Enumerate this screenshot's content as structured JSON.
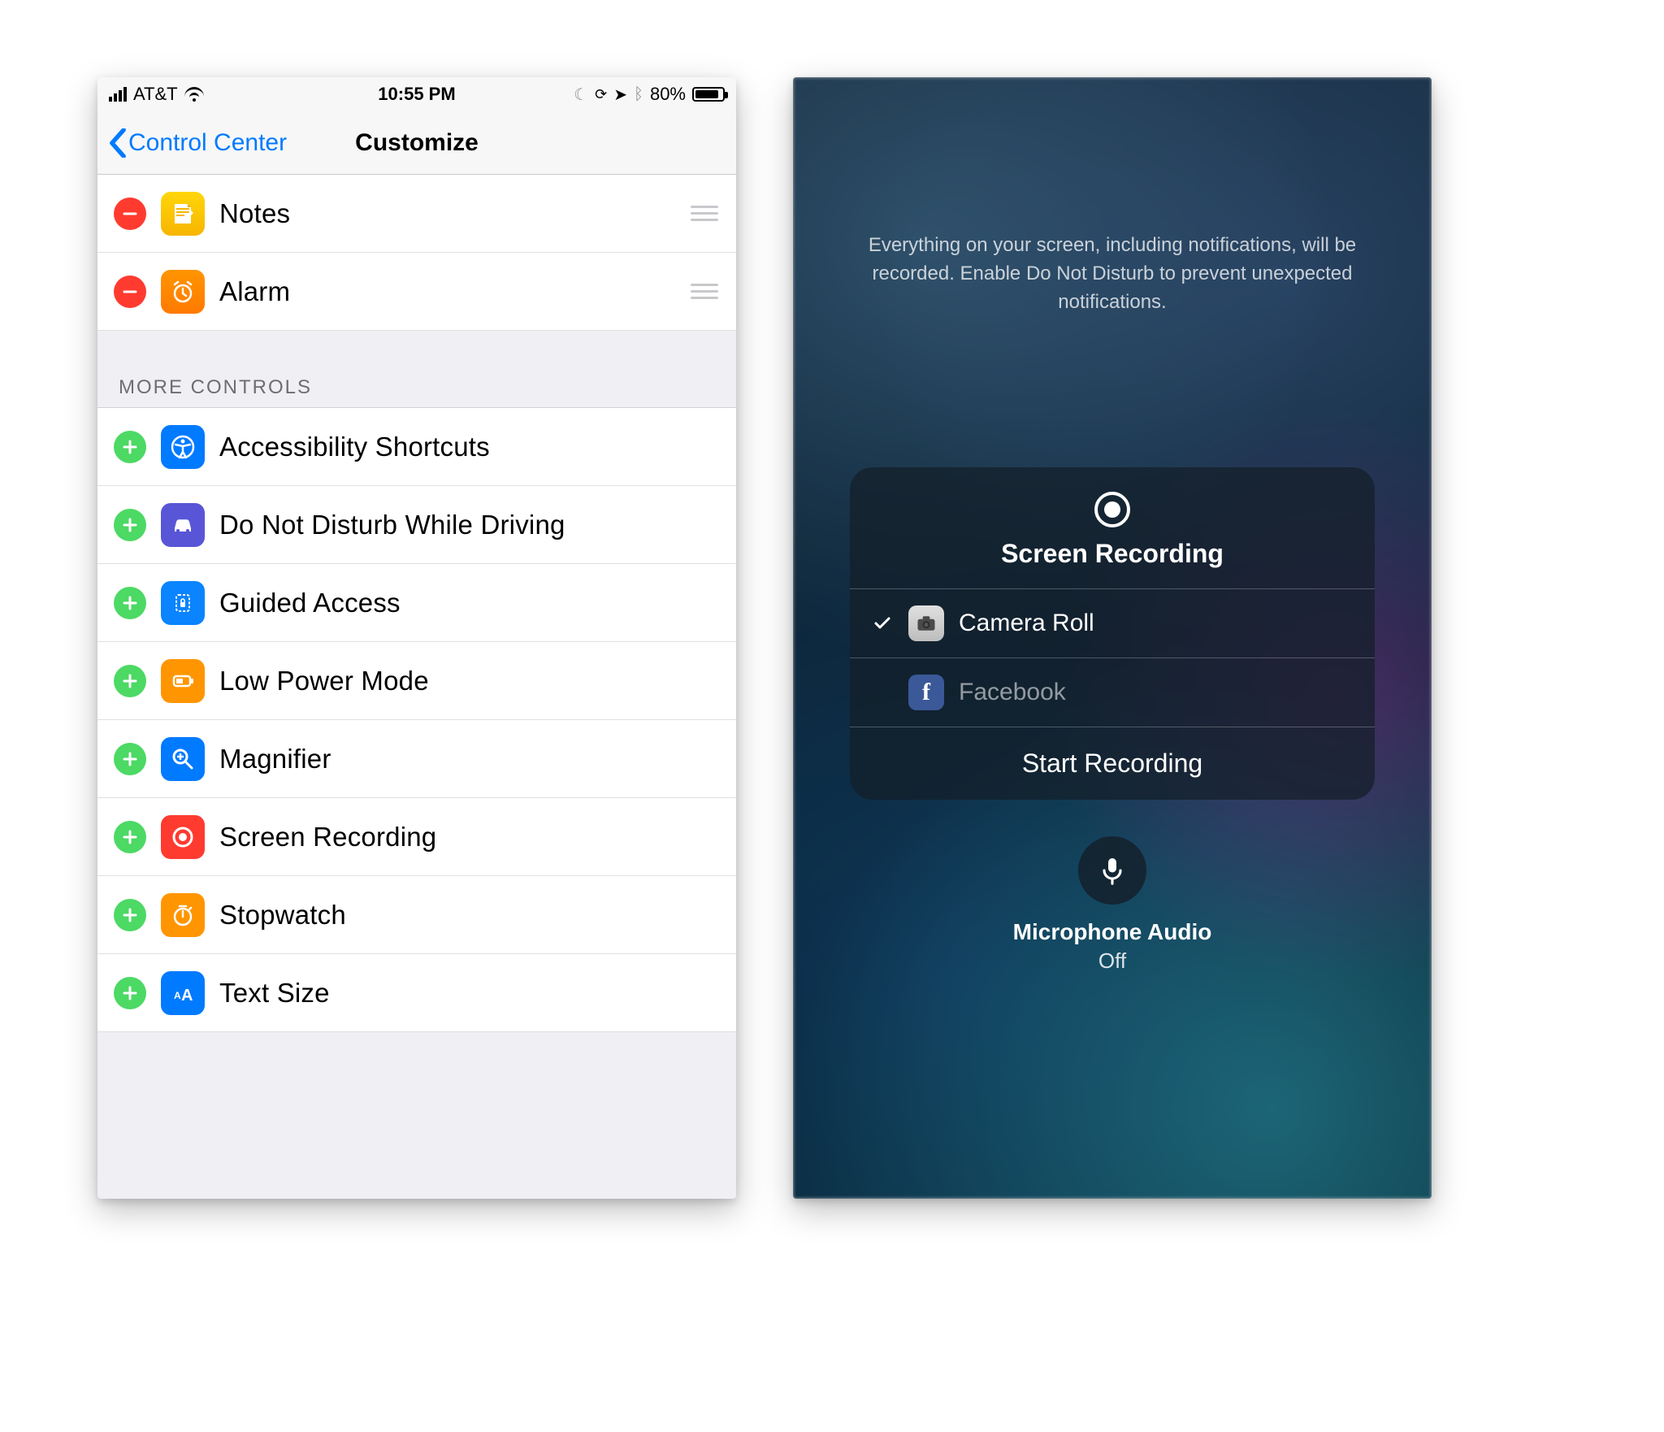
{
  "statusbar": {
    "carrier": "AT&T",
    "time": "10:55 PM",
    "battery_pct": "80%"
  },
  "nav": {
    "back_label": "Control Center",
    "title": "Customize"
  },
  "section_more": "MORE CONTROLS",
  "included": [
    {
      "label": "Notes"
    },
    {
      "label": "Alarm"
    }
  ],
  "more": [
    {
      "label": "Accessibility Shortcuts"
    },
    {
      "label": "Do Not Disturb While Driving"
    },
    {
      "label": "Guided Access"
    },
    {
      "label": "Low Power Mode"
    },
    {
      "label": "Magnifier"
    },
    {
      "label": "Screen Recording"
    },
    {
      "label": "Stopwatch"
    },
    {
      "label": "Text Size"
    }
  ],
  "recording": {
    "info": "Everything on your screen, including notifications, will be recorded. Enable Do Not Disturb to prevent unexpected notifications.",
    "title": "Screen Recording",
    "options": {
      "camera_roll": "Camera Roll",
      "facebook": "Facebook"
    },
    "action": "Start Recording",
    "mic_label": "Microphone Audio",
    "mic_state": "Off"
  }
}
